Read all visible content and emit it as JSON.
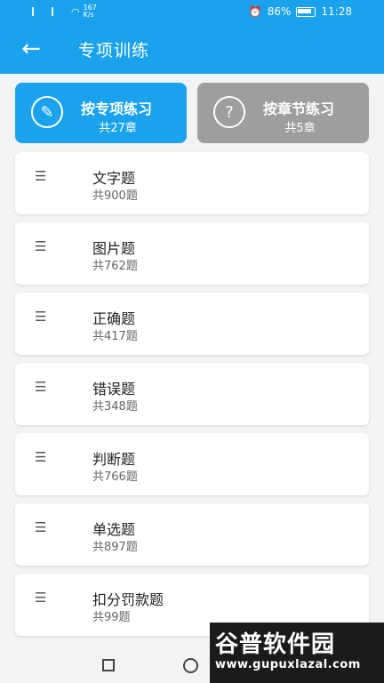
{
  "status": {
    "net_speed": "167\nK/s",
    "battery": "86%",
    "time": "11:28"
  },
  "app_bar": {
    "title": "专项训练"
  },
  "modes": [
    {
      "label": "按专项练习",
      "count": "共27章",
      "icon": "edit-circle-icon"
    },
    {
      "label": "按章节练习",
      "count": "共5章",
      "icon": "question-circle-icon"
    }
  ],
  "items": [
    {
      "title": "文字题",
      "count": "共900题"
    },
    {
      "title": "图片题",
      "count": "共762题"
    },
    {
      "title": "正确题",
      "count": "共417题"
    },
    {
      "title": "错误题",
      "count": "共348题"
    },
    {
      "title": "判断题",
      "count": "共766题"
    },
    {
      "title": "单选题",
      "count": "共897题"
    },
    {
      "title": "扣分罚款题",
      "count": "共99题"
    }
  ],
  "watermark": {
    "title": "谷普软件园",
    "url": "www.gupuxlazal.com"
  },
  "colors": {
    "primary": "#1aa3ec",
    "inactive": "#9e9e9e"
  }
}
